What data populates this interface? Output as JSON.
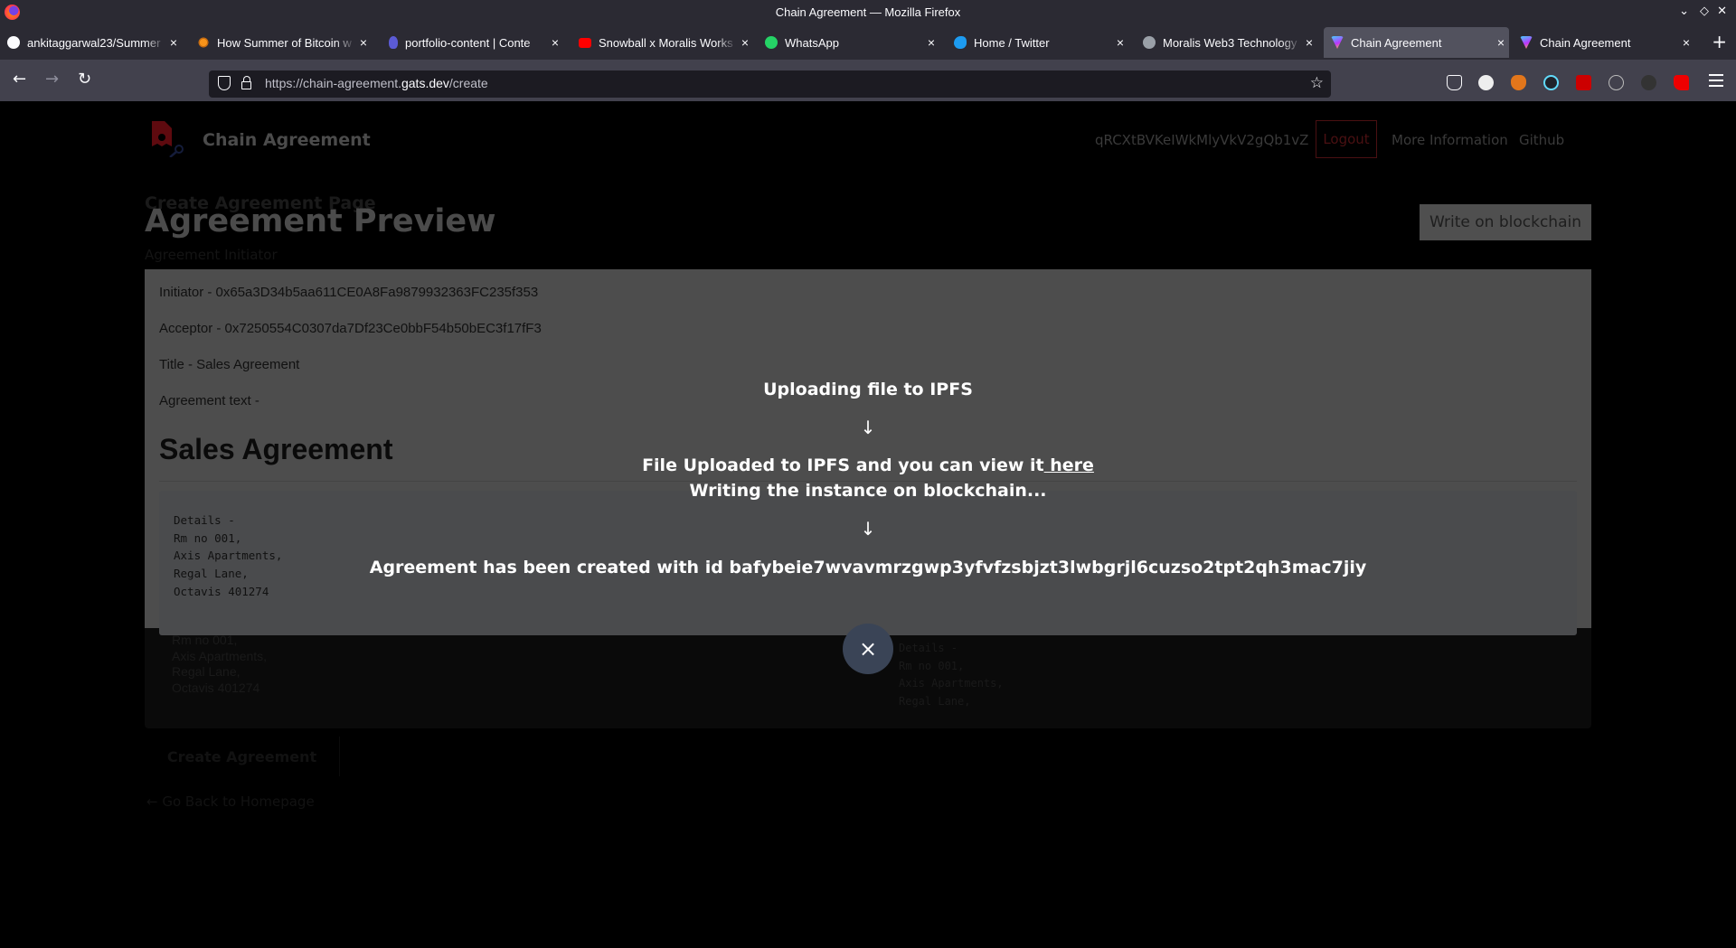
{
  "window": {
    "title": "Chain Agreement — Mozilla Firefox",
    "controls": {
      "minimize": "⌄",
      "maximize": "◇",
      "close": "✕"
    }
  },
  "tabs": [
    {
      "label": "ankitaggarwal23/Summer",
      "icon": "github-icon",
      "active": false
    },
    {
      "label": "How Summer of Bitcoin w",
      "icon": "summer-of-bitcoin-icon",
      "active": false
    },
    {
      "label": "portfolio-content | Conte",
      "icon": "portfolio-icon",
      "active": false
    },
    {
      "label": "Snowball x Moralis Works",
      "icon": "youtube-icon",
      "active": false
    },
    {
      "label": "WhatsApp",
      "icon": "whatsapp-icon",
      "active": false
    },
    {
      "label": "Home / Twitter",
      "icon": "twitter-icon",
      "active": false
    },
    {
      "label": "Moralis Web3 Technology",
      "icon": "moralis-icon",
      "active": false
    },
    {
      "label": "Chain Agreement",
      "icon": "vite-icon",
      "active": true
    },
    {
      "label": "Chain Agreement",
      "icon": "vite-icon",
      "active": false
    }
  ],
  "tab_close": "×",
  "new_tab": "+",
  "toolbar": {
    "back": "←",
    "forward": "→",
    "reload": "↻",
    "url_prefix": "https://chain-agreement.",
    "url_domain": "gats.dev",
    "url_suffix": "/create",
    "bookmark": "☆"
  },
  "extensions": [
    "pocket-icon",
    "grammarly-icon",
    "metamask-icon",
    "react-devtools-icon",
    "magic-wand-icon",
    "cookie-icon",
    "undo-icon",
    "youtube-ext-icon"
  ],
  "header": {
    "brand": "Chain Agreement",
    "user_id": "qRCXtBVKeIWkMlyVkV2gQb1vZ",
    "logout": "Logout",
    "more_info": "More Information",
    "github": "Github"
  },
  "page": {
    "ghost_heading": "Create Agreement Page",
    "ghost_subheading": "Agreement Initiator",
    "preview_title": "Agreement Preview",
    "write_button": "Write on blockchain",
    "create_button": "Create Agreement",
    "back_link": "← Go Back to Homepage"
  },
  "preview": {
    "initiator": "Initiator - 0x65a3D34b5aa611CE0A8Fa9879932363FC235f353",
    "acceptor": "Acceptor - 0x7250554C0307da7Df23Ce0bbF54b50bEC3f17fF3",
    "title": "Title - Sales Agreement",
    "text_label": "Agreement text -",
    "markdown_heading": "Sales Agreement",
    "details": "Details -\nRm no 001,\nAxis Apartments,\nRegal Lane,\nOctavis 401274",
    "details_bg_lines": "Rm no 001,\nAxis Apartments,\nRegal Lane,\nOctavis 401274",
    "details_bg_right": "Details -\nRm no 001,\nAxis Apartments,\nRegal Lane,"
  },
  "status": {
    "step1": "Uploading file to IPFS",
    "arrow": "↓",
    "step2_text": "File Uploaded to IPFS and you can view it",
    "step2_link": " here",
    "step3": "Writing the instance on blockchain...",
    "step4": "Agreement has been created with id bafybeie7wvavmrzgwp3yfvfzsbjzt3lwbgrjl6cuzso2tpt2qh3mac7jiy"
  },
  "modal_close": "×",
  "colors": {
    "modal_bg": "#4d4d4d",
    "close_button": "#3a4456",
    "logout_border": "#4a1012"
  }
}
